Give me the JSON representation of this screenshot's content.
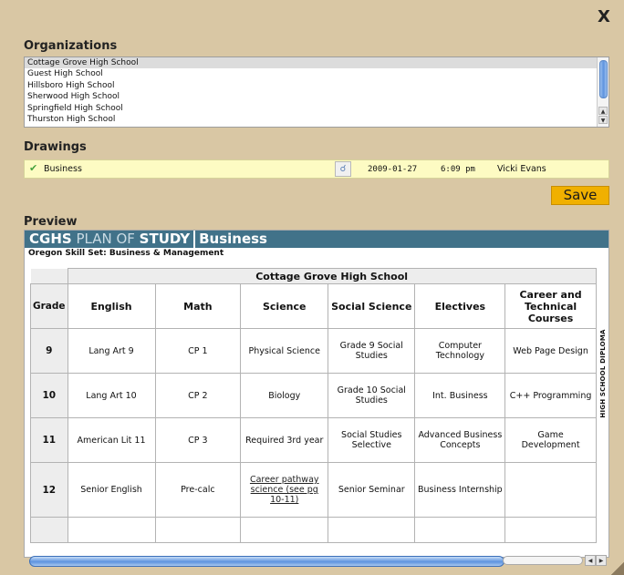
{
  "dialog": {
    "close_label": "X"
  },
  "organizations": {
    "title": "Organizations",
    "items": [
      "Cottage Grove High School",
      "Guest High School",
      "Hillsboro High School",
      "Sherwood High School",
      "Springfield High School",
      "Thurston High School"
    ],
    "selected_index": 0
  },
  "drawings": {
    "title": "Drawings",
    "row": {
      "name": "Business",
      "date": "2009-01-27",
      "time": "6:09 pm",
      "author": "Vicki Evans"
    },
    "save_label": "Save"
  },
  "preview": {
    "title": "Preview",
    "banner": {
      "part1": "CGHS",
      "part2": " PLAN OF ",
      "part3": "STUDY",
      "part4": "Business"
    },
    "subtitle": "Oregon Skill Set: Business & Management",
    "school": "Cottage Grove High School",
    "headers": [
      "Grade",
      "English",
      "Math",
      "Science",
      "Social Science",
      "Electives",
      "Career and Technical Courses"
    ],
    "rows": [
      [
        "9",
        "Lang Art 9",
        "CP 1",
        "Physical Science",
        "Grade 9 Social Studies",
        "Computer Technology",
        "Web Page Design"
      ],
      [
        "10",
        "Lang Art 10",
        "CP 2",
        "Biology",
        "Grade 10 Social Studies",
        "Int. Business",
        "C++ Programming"
      ],
      [
        "11",
        "American Lit 11",
        "CP 3",
        "Required 3rd year",
        "Social Studies Selective",
        "Advanced Business Concepts",
        "Game Development"
      ],
      [
        "12",
        "Senior English",
        "Pre-calc",
        "Career pathway science (see pg 10-11)",
        "Senior Seminar",
        "Business Internship",
        ""
      ]
    ],
    "side_label": "HIGH SCHOOL DIPLOMA"
  },
  "scroll": {
    "horizontal_fraction": 0.86
  }
}
